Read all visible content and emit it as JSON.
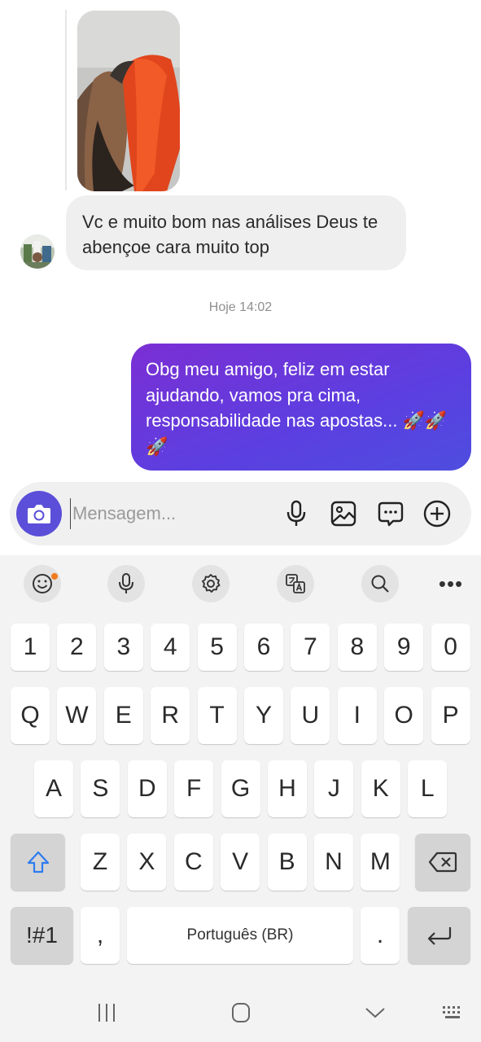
{
  "chat": {
    "incoming_message": "Vc e muito bom nas análises  Deus te abençoe cara muito top",
    "timestamp": "Hoje 14:02",
    "outgoing_message": "Obg meu amigo, feliz em estar ajudando, vamos pra cima, responsabilidade nas apostas... 🚀🚀🚀"
  },
  "composer": {
    "placeholder": "Mensagem...",
    "icons": [
      "camera-icon",
      "microphone-icon",
      "gallery-icon",
      "chat-bubble-icon",
      "plus-circle-icon"
    ]
  },
  "keyboard": {
    "toolbar_icons": [
      "emoji-icon",
      "voice-input-icon",
      "settings-icon",
      "translate-icon",
      "search-icon",
      "more-icon"
    ],
    "toolbar_more": "•••",
    "number_row": [
      "1",
      "2",
      "3",
      "4",
      "5",
      "6",
      "7",
      "8",
      "9",
      "0"
    ],
    "row1": [
      "Q",
      "W",
      "E",
      "R",
      "T",
      "Y",
      "U",
      "I",
      "O",
      "P"
    ],
    "row2": [
      "A",
      "S",
      "D",
      "F",
      "G",
      "H",
      "J",
      "K",
      "L"
    ],
    "row3": [
      "Z",
      "X",
      "C",
      "V",
      "B",
      "N",
      "M"
    ],
    "symbols_label": "!#1",
    "comma_label": ",",
    "space_label": "Português (BR)",
    "period_label": "."
  },
  "colors": {
    "accent": "#5b4fd9",
    "outgoing_gradient_start": "#7b2fd4",
    "outgoing_gradient_end": "#4e4ddf",
    "notification_dot": "#f07a1e"
  }
}
